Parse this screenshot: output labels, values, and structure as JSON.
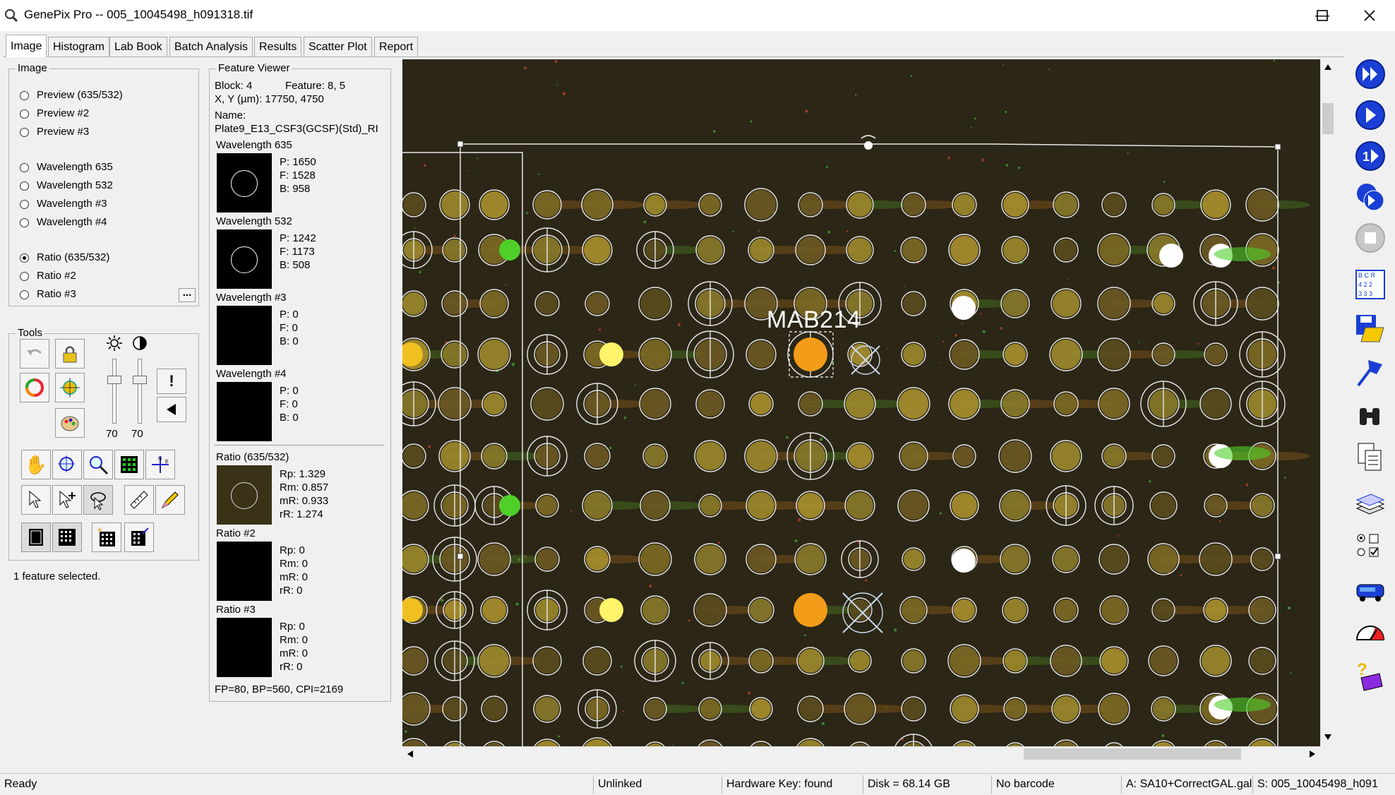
{
  "window": {
    "title": "GenePix Pro -- 005_10045498_h091318.tif",
    "icons": [
      "magnifier-app-icon"
    ]
  },
  "tabs": [
    {
      "label": "Image"
    },
    {
      "label": "Histogram"
    },
    {
      "label": "Lab Book"
    },
    {
      "label": "Batch Analysis"
    },
    {
      "label": "Results"
    },
    {
      "label": "Scatter Plot"
    },
    {
      "label": "Report"
    }
  ],
  "image_group": {
    "label": "Image",
    "options": [
      "Preview (635/532)",
      "Preview #2",
      "Preview #3",
      "Wavelength 635",
      "Wavelength 532",
      "Wavelength #3",
      "Wavelength #4",
      "Ratio (635/532)",
      "Ratio #2",
      "Ratio #3"
    ],
    "selected": "Ratio (635/532)",
    "more_label": "..."
  },
  "tools": {
    "label": "Tools",
    "slider_values": [
      "70",
      "70"
    ],
    "status": "1 feature selected."
  },
  "feature_viewer": {
    "label": "Feature Viewer",
    "block": "Block: 4",
    "feature": "Feature:  8, 5",
    "xy": "X, Y (µm): 17750, 4750",
    "name_label": "Name:",
    "name": "Plate9_E13_CSF3(GCSF)(Std)_RI",
    "wavelengths": [
      {
        "title": "Wavelength 635",
        "p": "P:    1650",
        "f": "F:    1528",
        "b": "B:    958"
      },
      {
        "title": "Wavelength 532",
        "p": "P:    1242",
        "f": "F:    1173",
        "b": "B:    508"
      },
      {
        "title": "Wavelength #3",
        "p": "P:    0",
        "f": "F:    0",
        "b": "B:    0"
      },
      {
        "title": "Wavelength #4",
        "p": "P:    0",
        "f": "F:    0",
        "b": "B:    0"
      }
    ],
    "ratios": [
      {
        "title": "Ratio (635/532)",
        "rp": "Rp:  1.329",
        "rm": "Rm:  0.857",
        "mr": "mR:  0.933",
        "rr": "rR:  1.274"
      },
      {
        "title": "Ratio #2",
        "rp": "Rp:  0",
        "rm": "Rm:  0",
        "mr": "mR:  0",
        "rr": "rR:  0"
      },
      {
        "title": "Ratio #3",
        "rp": "Rp:  0",
        "rm": "Rm:  0",
        "mr": "mR:  0",
        "rr": "rR:  0"
      }
    ],
    "footer": "FP=80, BP=560, CPI=2169"
  },
  "image_view": {
    "annotation": "MAB214"
  },
  "status_bar": {
    "ready": "Ready",
    "link": "Unlinked",
    "hardware": "Hardware Key: found",
    "disk": "Disk = 68.14 GB",
    "barcode": "No barcode",
    "gal": "A: SA10+CorrectGAL.gal",
    "scan": "S: 005_10045498_h091"
  },
  "colors": {
    "accent_blue": "#1a3fd4",
    "image_bg": "#2b2616",
    "orange_spot": "#f39c1a",
    "green_spot": "#4fcf2a"
  }
}
